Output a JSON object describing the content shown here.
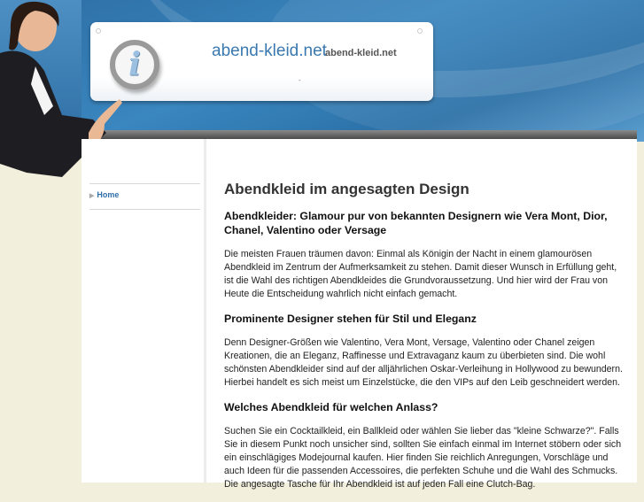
{
  "header": {
    "site_title": "abend-kleid.net",
    "site_subtitle": "abend-kleid.net",
    "tagline": "-",
    "icon": "info-icon"
  },
  "sidebar": {
    "items": [
      {
        "label": "Home",
        "icon": "triangle-right-icon"
      }
    ]
  },
  "main": {
    "title": "Abendkleid im angesagten Design",
    "sections": [
      {
        "heading": "Abendkleider: Glamour pur von bekannten Designern wie Vera Mont, Dior, Chanel, Valentino oder Versage",
        "text": "Die meisten Frauen träumen davon: Einmal als Königin der Nacht in einem glamourösen Abendkleid im Zentrum der Aufmerksamkeit zu stehen. Damit dieser Wunsch in Erfüllung geht, ist die Wahl des richtigen Abendkleides die Grundvoraussetzung. Und hier wird der Frau von Heute die Entscheidung wahrlich nicht einfach gemacht."
      },
      {
        "heading": "Prominente Designer stehen für Stil und Eleganz",
        "text": "Denn Designer-Größen wie Valentino, Vera Mont, Versage, Valentino oder Chanel zeigen Kreationen, die an Eleganz, Raffinesse und Extravaganz kaum zu überbieten sind. Die wohl schönsten Abendkleider sind auf der alljährlichen Oskar-Verleihung in Hollywood zu bewundern. Hierbei handelt es sich meist um Einzelstücke, die den VIPs auf den Leib geschneidert werden."
      },
      {
        "heading": "Welches Abendkleid für welchen Anlass?",
        "text": "Suchen Sie ein Cocktailkleid, ein Ballkleid oder wählen Sie lieber das \"kleine Schwarze?\". Falls Sie in diesem Punkt noch unsicher sind, sollten Sie einfach einmal im Internet stöbern oder sich ein einschlägiges Modejournal kaufen. Hier finden Sie reichlich Anregungen, Vorschläge und auch Ideen für die passenden Accessoires, die perfekten Schuhe und die Wahl des Schmucks. Die angesagte Tasche für Ihr Abendkleid ist auf jeden Fall eine Clutch-Bag."
      }
    ]
  }
}
